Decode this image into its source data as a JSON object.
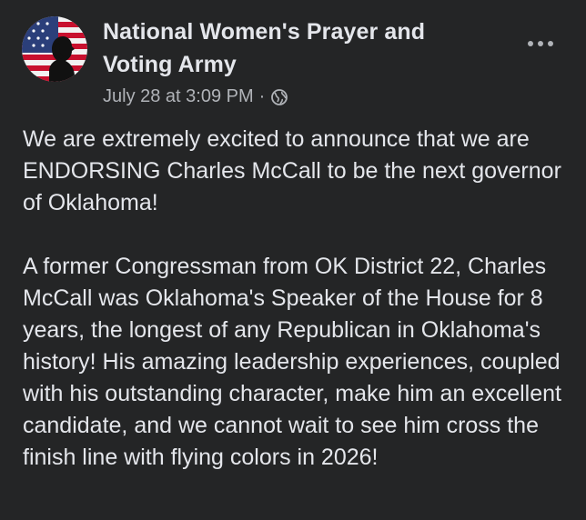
{
  "post": {
    "author": "National Women's Prayer and Voting Army",
    "timestamp": "July 28 at 3:09 PM",
    "separator": "·",
    "audience_icon": "globe-icon",
    "more_icon": "more-options-icon",
    "paragraphs": [
      "We are extremely excited to announce that we are ENDORSING Charles McCall to be the next governor of Oklahoma!",
      "A former Congressman from OK District 22, Charles McCall was Oklahoma's Speaker of the House for 8 years, the longest of any Republican in Oklahoma's history! His amazing leadership experiences, coupled with his outstanding character, make him an excellent candidate, and we cannot wait to see him cross the finish line with flying colors in 2026!"
    ]
  },
  "colors": {
    "background": "#242526",
    "primary_text": "#e4e6eb",
    "secondary_text": "#b0b3b8"
  }
}
